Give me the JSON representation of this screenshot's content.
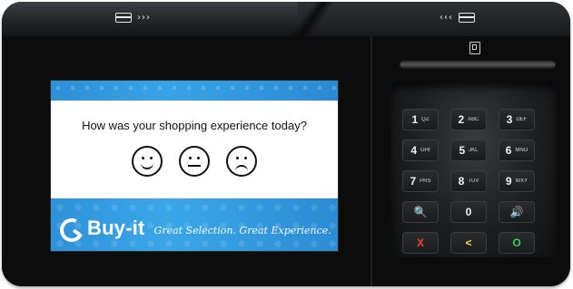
{
  "device": {
    "top_indicators": {
      "left": {
        "icon": "card-swipe-icon",
        "chevrons": "›››"
      },
      "right": {
        "icon": "card-swipe-icon",
        "chevrons": "‹‹‹"
      }
    },
    "card_slot_icon": "chip-card-icon"
  },
  "screen": {
    "question": "How was your shopping experience today?",
    "faces": [
      {
        "name": "happy-face-icon",
        "mood": "happy"
      },
      {
        "name": "neutral-face-icon",
        "mood": "neutral"
      },
      {
        "name": "sad-face-icon",
        "mood": "sad"
      }
    ],
    "brand": {
      "name": "Buy-it",
      "tagline": "Great Selection. Great Experience."
    },
    "accent_color": "#2e91d9"
  },
  "keypad": {
    "rows": [
      [
        {
          "label": "1",
          "sub": "QZ"
        },
        {
          "label": "2",
          "sub": "ABC"
        },
        {
          "label": "3",
          "sub": "DEF"
        }
      ],
      [
        {
          "label": "4",
          "sub": "GHI"
        },
        {
          "label": "5",
          "sub": "JKL"
        },
        {
          "label": "6",
          "sub": "MNO"
        }
      ],
      [
        {
          "label": "7",
          "sub": "PRS"
        },
        {
          "label": "8",
          "sub": "TUV"
        },
        {
          "label": "9",
          "sub": "WXY"
        }
      ],
      [
        {
          "label": "🔍",
          "sub": ""
        },
        {
          "label": "0",
          "sub": ""
        },
        {
          "label": "🔊",
          "sub": ""
        }
      ],
      [
        {
          "label": "X",
          "sub": ""
        },
        {
          "label": "<",
          "sub": ""
        },
        {
          "label": "O",
          "sub": ""
        }
      ]
    ],
    "colors": {
      "cancel": "#ff3b36",
      "back": "#f7e14b",
      "ok": "#39d05a"
    }
  }
}
